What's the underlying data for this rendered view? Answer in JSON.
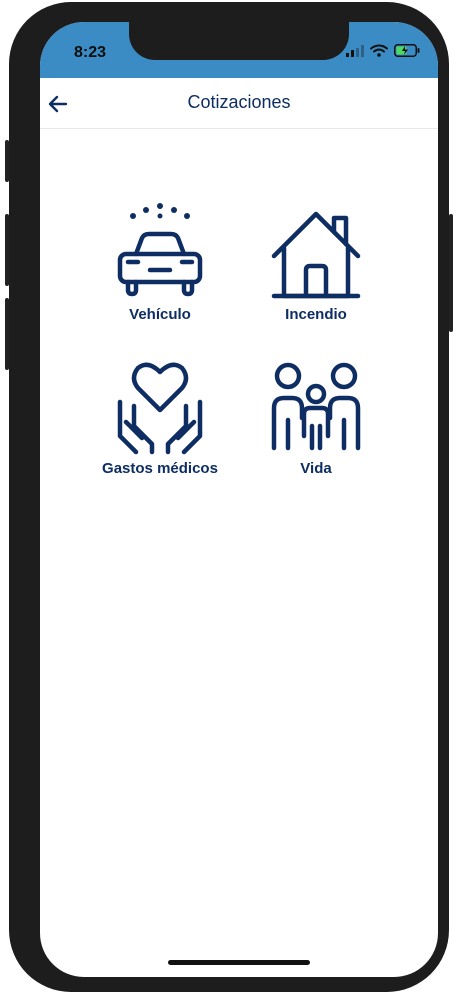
{
  "status_bar": {
    "time": "8:23"
  },
  "header": {
    "title": "Cotizaciones"
  },
  "options": [
    {
      "label": "Vehículo",
      "icon": "car-icon"
    },
    {
      "label": "Incendio",
      "icon": "house-icon"
    },
    {
      "label": "Gastos médicos",
      "icon": "heart-hands-icon"
    },
    {
      "label": "Vida",
      "icon": "family-icon"
    }
  ],
  "colors": {
    "primary": "#0e2e63",
    "status_bar": "#3b8cc4"
  }
}
